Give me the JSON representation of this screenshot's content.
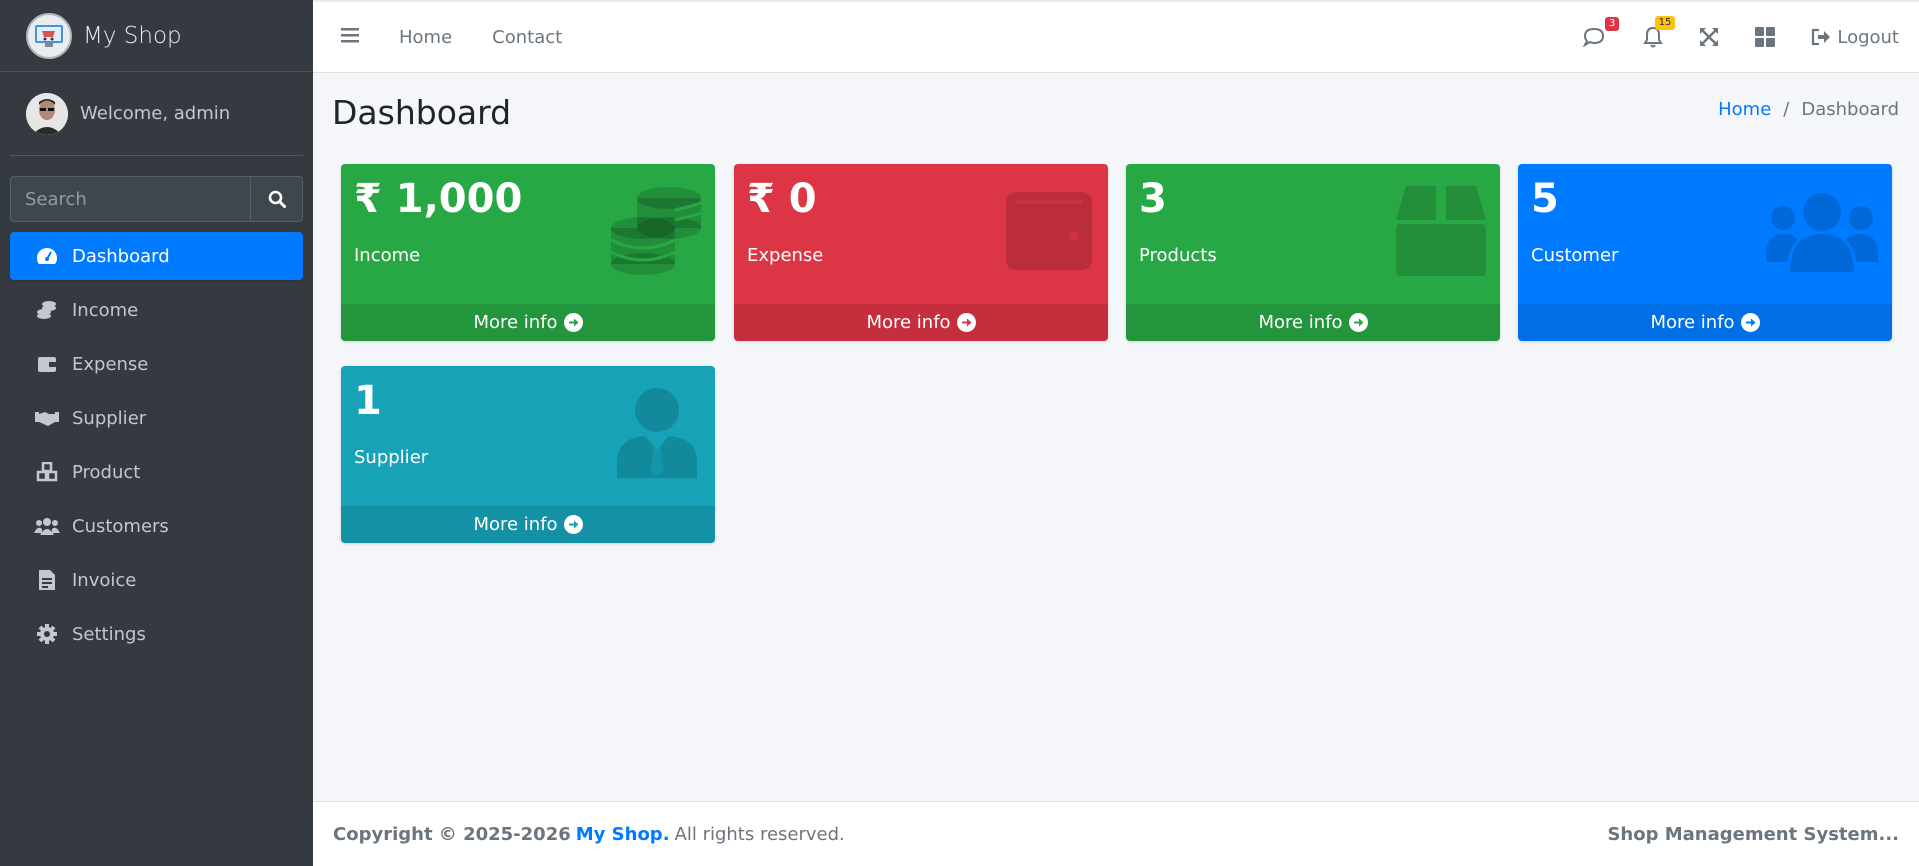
{
  "brand": {
    "name": "My Shop"
  },
  "user": {
    "welcome": "Welcome, admin"
  },
  "sidebar": {
    "search_placeholder": "Search",
    "items": [
      {
        "label": "Dashboard",
        "icon": "tachometer-icon",
        "active": true
      },
      {
        "label": "Income",
        "icon": "coins-icon"
      },
      {
        "label": "Expense",
        "icon": "wallet-icon"
      },
      {
        "label": "Supplier",
        "icon": "handshake-icon"
      },
      {
        "label": "Product",
        "icon": "cubes-icon"
      },
      {
        "label": "Customers",
        "icon": "users-icon"
      },
      {
        "label": "Invoice",
        "icon": "file-invoice-icon"
      },
      {
        "label": "Settings",
        "icon": "gear-icon"
      }
    ]
  },
  "topbar": {
    "links": [
      "Home",
      "Contact"
    ],
    "messages_count": "3",
    "notifications_count": "15",
    "logout_label": "Logout"
  },
  "page": {
    "title": "Dashboard",
    "breadcrumb": [
      "Home",
      "Dashboard"
    ]
  },
  "boxes": [
    {
      "value": "₹ 1,000",
      "label": "Income",
      "footer": "More info",
      "color": "#28a745",
      "icon": "coins-icon"
    },
    {
      "value": "₹ 0",
      "label": "Expense",
      "footer": "More info",
      "color": "#dc3545",
      "icon": "wallet-icon"
    },
    {
      "value": "3",
      "label": "Products",
      "footer": "More info",
      "color": "#28a745",
      "icon": "box-icon"
    },
    {
      "value": "5",
      "label": "Customer",
      "footer": "More info",
      "color": "#007bff",
      "icon": "users-icon"
    },
    {
      "value": "1",
      "label": "Supplier",
      "footer": "More info",
      "color": "#17a2b8",
      "icon": "user-tie-icon"
    }
  ],
  "footer": {
    "copyright": "Copyright © 2025-2026",
    "brand": "My Shop.",
    "rights": "All rights reserved.",
    "right_text": "Shop Management System..."
  }
}
